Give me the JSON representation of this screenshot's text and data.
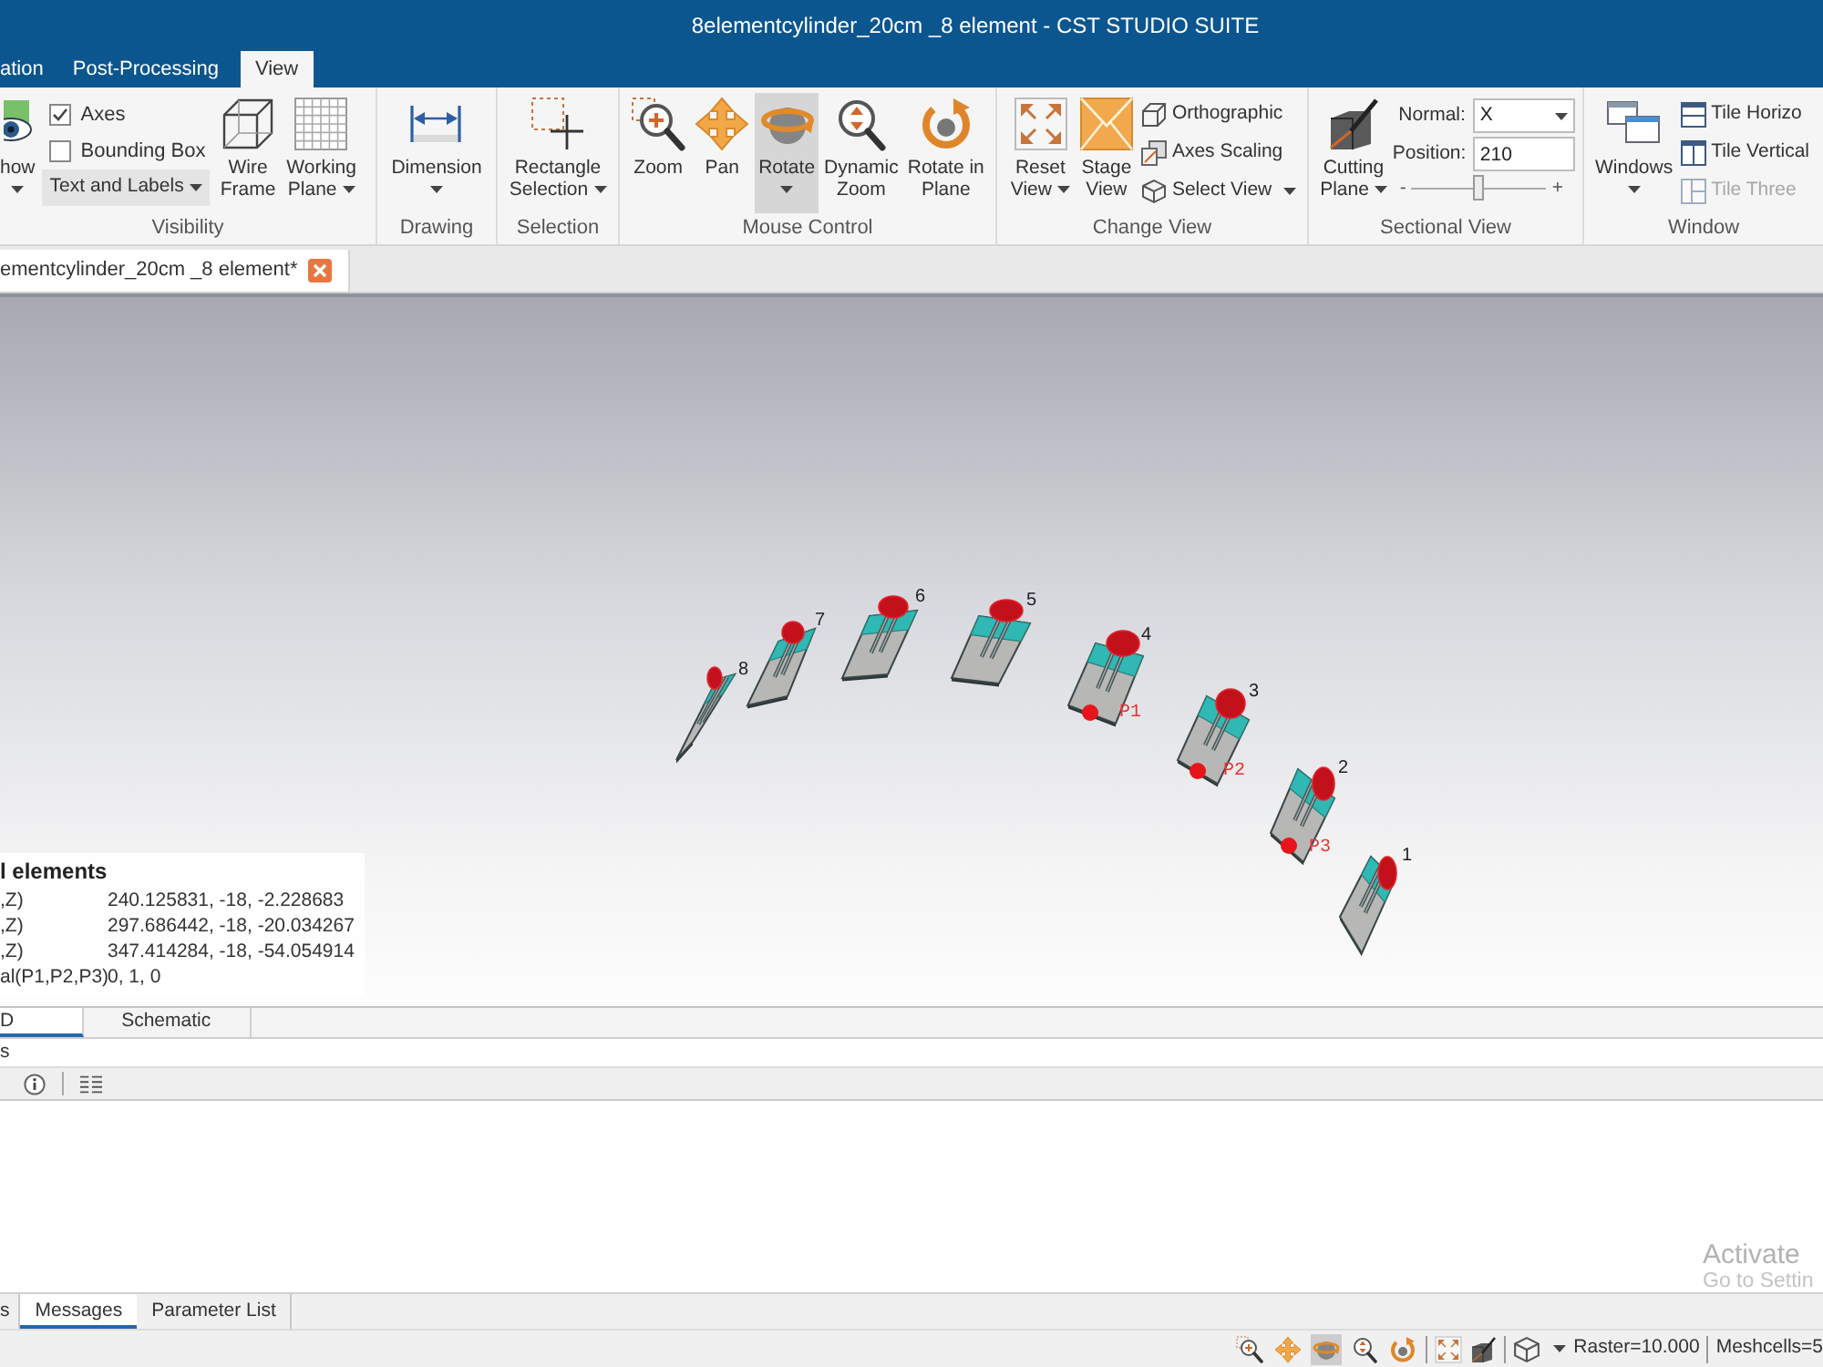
{
  "window": {
    "title": "8elementcylinder_20cm _8 element - CST STUDIO SUITE"
  },
  "ribbon": {
    "tabs": [
      {
        "label": "ation",
        "selected": false
      },
      {
        "label": "Post-Processing",
        "selected": false
      },
      {
        "label": "View",
        "selected": true
      }
    ],
    "groups": [
      {
        "label": "Visibility",
        "items": [
          {
            "kind": "large",
            "label": "how",
            "dropdown": true
          },
          {
            "kind": "checks",
            "entries": [
              {
                "kind": "check",
                "label": "Axes",
                "checked": true
              },
              {
                "kind": "check",
                "label": "Bounding Box",
                "checked": false
              },
              {
                "kind": "menu",
                "label": "Text and Labels"
              }
            ]
          },
          {
            "kind": "large",
            "label": "Wire\nFrame"
          },
          {
            "kind": "large",
            "label": "Working\nPlane",
            "dropdown": true
          }
        ]
      },
      {
        "label": "Drawing",
        "items": [
          {
            "kind": "large",
            "label": "Dimension",
            "dropdown": true
          }
        ]
      },
      {
        "label": "Selection",
        "items": [
          {
            "kind": "large",
            "label": "Rectangle\nSelection",
            "dropdown": true
          }
        ]
      },
      {
        "label": "Mouse Control",
        "items": [
          {
            "kind": "large",
            "label": "Zoom",
            "selected": false
          },
          {
            "kind": "large",
            "label": "Pan",
            "selected": false
          },
          {
            "kind": "large",
            "label": "Rotate",
            "dropdown": true,
            "selected": true
          },
          {
            "kind": "large",
            "label": "Dynamic\nZoom",
            "selected": false
          },
          {
            "kind": "large",
            "label": "Rotate in\nPlane",
            "selected": false
          }
        ]
      },
      {
        "label": "Change View",
        "items": [
          {
            "kind": "large",
            "label": "Reset\nView",
            "dropdown": true
          },
          {
            "kind": "large",
            "label": "Stage\nView"
          },
          {
            "kind": "smalls",
            "entries": [
              {
                "label": "Orthographic"
              },
              {
                "label": "Axes Scaling"
              },
              {
                "label": "Select View",
                "dropdown": true
              }
            ]
          }
        ]
      },
      {
        "label": "Sectional View",
        "items": [
          {
            "kind": "large",
            "label": "Cutting\nPlane",
            "dropdown": true
          },
          {
            "kind": "section",
            "normal_label": "Normal:",
            "normal_value": "X",
            "position_label": "Position:",
            "position_value": "210",
            "slider": {
              "min_label": "-",
              "max_label": "+",
              "level": 0.5
            }
          }
        ]
      },
      {
        "label": "Window",
        "items": [
          {
            "kind": "large",
            "label": "Windows",
            "dropdown": true
          },
          {
            "kind": "smalls",
            "entries": [
              {
                "label": "Tile Horizo",
                "disabled": false
              },
              {
                "label": "Tile Vertical",
                "disabled": false
              },
              {
                "label": "Tile Three",
                "disabled": true
              }
            ]
          }
        ]
      }
    ]
  },
  "document_tabs": [
    {
      "label": "ementcylinder_20cm _8 element*",
      "selected": true
    }
  ],
  "viewport": {
    "elements": [
      {
        "label": "8"
      },
      {
        "label": "7"
      },
      {
        "label": "6"
      },
      {
        "label": "5"
      },
      {
        "label": "4",
        "port": "P1"
      },
      {
        "label": "3",
        "port": "P2"
      },
      {
        "label": "2",
        "port": "P3"
      },
      {
        "label": "1"
      }
    ],
    "info_panel": {
      "title": "l elements",
      "rows": [
        {
          "key": ",Z)",
          "value": "240.125831, -18, -2.228683"
        },
        {
          "key": ",Z)",
          "value": "297.686442, -18, -20.034267"
        },
        {
          "key": ",Z)",
          "value": "347.414284, -18, -54.054914"
        },
        {
          "key": "al(P1,P2,P3)",
          "value": "0, 1, 0"
        }
      ]
    }
  },
  "view_tabs": [
    {
      "label": "D",
      "selected": true
    },
    {
      "label": "Schematic",
      "selected": false
    }
  ],
  "messages_panel": {
    "title": "s"
  },
  "bottom_tabs": [
    {
      "label": "s",
      "selected": false
    },
    {
      "label": "Messages",
      "selected": true
    },
    {
      "label": "Parameter List",
      "selected": false
    }
  ],
  "status_bar": {
    "tools": [
      {
        "selected": false
      },
      {
        "selected": false
      },
      {
        "selected": true
      },
      {
        "selected": false
      },
      {
        "selected": false
      }
    ],
    "raster": "Raster=10.000",
    "meshcells": "Meshcells=5"
  },
  "activation_notice": {
    "title": "Activate",
    "subtitle": "Go to Settin"
  }
}
